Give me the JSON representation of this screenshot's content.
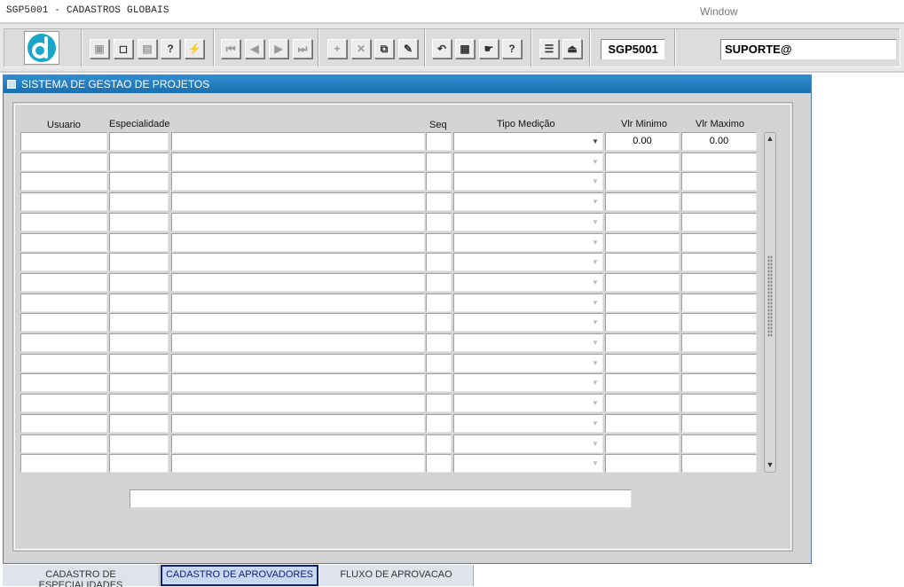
{
  "app": {
    "title": "SGP5001 - CADASTROS GLOBAIS",
    "window_menu": "Window"
  },
  "toolbar": {
    "module_code": "SGP5001",
    "user": "SUPORTE@",
    "buttons": [
      {
        "icon": "save-icon",
        "glyph": "▣",
        "enabled": false
      },
      {
        "icon": "window-icon",
        "glyph": "◻",
        "enabled": true
      },
      {
        "icon": "print-icon",
        "glyph": "▤",
        "enabled": false
      },
      {
        "icon": "query-icon",
        "glyph": "?",
        "enabled": true
      },
      {
        "icon": "execute-query-icon",
        "glyph": "⚡",
        "enabled": true
      },
      {
        "icon": "first-record-icon",
        "glyph": "⏮",
        "enabled": false
      },
      {
        "icon": "previous-record-icon",
        "glyph": "◀",
        "enabled": false
      },
      {
        "icon": "next-record-icon",
        "glyph": "▶",
        "enabled": false
      },
      {
        "icon": "last-record-icon",
        "glyph": "⏭",
        "enabled": false
      },
      {
        "icon": "insert-record-icon",
        "glyph": "+",
        "enabled": false
      },
      {
        "icon": "delete-record-icon",
        "glyph": "✕",
        "enabled": false
      },
      {
        "icon": "duplicate-record-icon",
        "glyph": "⧉",
        "enabled": true
      },
      {
        "icon": "clear-record-icon",
        "glyph": "✎",
        "enabled": true
      },
      {
        "icon": "undo-icon",
        "glyph": "↶",
        "enabled": true
      },
      {
        "icon": "clipboard-icon",
        "glyph": "▦",
        "enabled": true
      },
      {
        "icon": "list-values-icon",
        "glyph": "☛",
        "enabled": true
      },
      {
        "icon": "help-icon",
        "glyph": "?",
        "enabled": true
      },
      {
        "icon": "menu-icon",
        "glyph": "☰",
        "enabled": true
      },
      {
        "icon": "exit-icon",
        "glyph": "⏏",
        "enabled": true
      }
    ]
  },
  "form": {
    "title": "SISTEMA DE GESTAO DE PROJETOS",
    "columns": {
      "usuario": "Usuario",
      "especialidade": "Especialidade",
      "seq": "Seq",
      "tipo_medicao": "Tipo Medição",
      "vlr_minimo": "Vlr Minimo",
      "vlr_maximo": "Vlr Maximo"
    },
    "rows": [
      {
        "usuario": "",
        "especialidade": "",
        "descricao": "",
        "seq": "",
        "tipo_medicao": "",
        "vlr_minimo": "0.00",
        "vlr_maximo": "0.00"
      },
      {
        "usuario": "",
        "especialidade": "",
        "descricao": "",
        "seq": "",
        "tipo_medicao": "",
        "vlr_minimo": "",
        "vlr_maximo": ""
      },
      {
        "usuario": "",
        "especialidade": "",
        "descricao": "",
        "seq": "",
        "tipo_medicao": "",
        "vlr_minimo": "",
        "vlr_maximo": ""
      },
      {
        "usuario": "",
        "especialidade": "",
        "descricao": "",
        "seq": "",
        "tipo_medicao": "",
        "vlr_minimo": "",
        "vlr_maximo": ""
      },
      {
        "usuario": "",
        "especialidade": "",
        "descricao": "",
        "seq": "",
        "tipo_medicao": "",
        "vlr_minimo": "",
        "vlr_maximo": ""
      },
      {
        "usuario": "",
        "especialidade": "",
        "descricao": "",
        "seq": "",
        "tipo_medicao": "",
        "vlr_minimo": "",
        "vlr_maximo": ""
      },
      {
        "usuario": "",
        "especialidade": "",
        "descricao": "",
        "seq": "",
        "tipo_medicao": "",
        "vlr_minimo": "",
        "vlr_maximo": ""
      },
      {
        "usuario": "",
        "especialidade": "",
        "descricao": "",
        "seq": "",
        "tipo_medicao": "",
        "vlr_minimo": "",
        "vlr_maximo": ""
      },
      {
        "usuario": "",
        "especialidade": "",
        "descricao": "",
        "seq": "",
        "tipo_medicao": "",
        "vlr_minimo": "",
        "vlr_maximo": ""
      },
      {
        "usuario": "",
        "especialidade": "",
        "descricao": "",
        "seq": "",
        "tipo_medicao": "",
        "vlr_minimo": "",
        "vlr_maximo": ""
      },
      {
        "usuario": "",
        "especialidade": "",
        "descricao": "",
        "seq": "",
        "tipo_medicao": "",
        "vlr_minimo": "",
        "vlr_maximo": ""
      },
      {
        "usuario": "",
        "especialidade": "",
        "descricao": "",
        "seq": "",
        "tipo_medicao": "",
        "vlr_minimo": "",
        "vlr_maximo": ""
      },
      {
        "usuario": "",
        "especialidade": "",
        "descricao": "",
        "seq": "",
        "tipo_medicao": "",
        "vlr_minimo": "",
        "vlr_maximo": ""
      },
      {
        "usuario": "",
        "especialidade": "",
        "descricao": "",
        "seq": "",
        "tipo_medicao": "",
        "vlr_minimo": "",
        "vlr_maximo": ""
      },
      {
        "usuario": "",
        "especialidade": "",
        "descricao": "",
        "seq": "",
        "tipo_medicao": "",
        "vlr_minimo": "",
        "vlr_maximo": ""
      },
      {
        "usuario": "",
        "especialidade": "",
        "descricao": "",
        "seq": "",
        "tipo_medicao": "",
        "vlr_minimo": "",
        "vlr_maximo": ""
      },
      {
        "usuario": "",
        "especialidade": "",
        "descricao": "",
        "seq": "",
        "tipo_medicao": "",
        "vlr_minimo": "",
        "vlr_maximo": ""
      }
    ],
    "status_text": ""
  },
  "tabs": [
    {
      "label": "CADASTRO DE ESPECIALIDADES",
      "active": false
    },
    {
      "label": "CADASTRO DE APROVADORES",
      "active": true
    },
    {
      "label": "FLUXO DE APROVACAO",
      "active": false
    }
  ],
  "colors": {
    "titlebar": "#1b6fb0",
    "active_tab_border": "#0b1f7a",
    "logo": "#1ba6c9"
  }
}
